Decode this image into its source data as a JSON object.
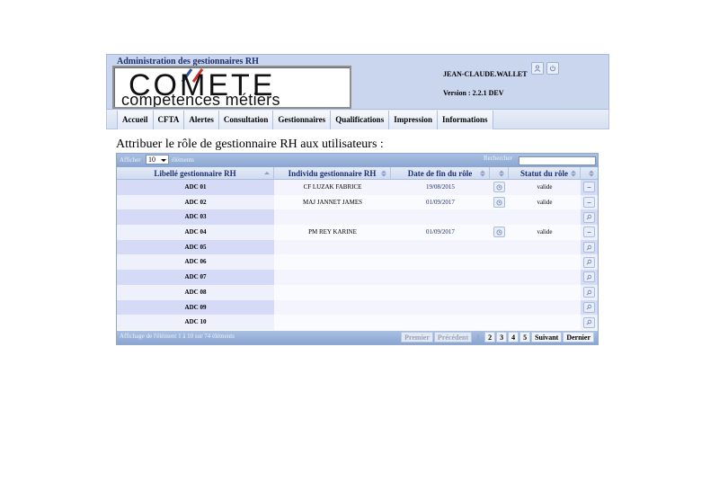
{
  "header": {
    "app_title": "Administration des gestionnaires RH",
    "logo": {
      "word": "COMETE",
      "subtitle": "compétences métiers"
    },
    "user_name": "JEAN-CLAUDE.WALLET",
    "version": "Version : 2.2.1 DEV",
    "icons": {
      "user": "user-icon",
      "power": "power-icon"
    }
  },
  "menu": [
    "Accueil",
    "CFTA",
    "Alertes",
    "Consultation",
    "Gestionnaires",
    "Qualifications",
    "Impression",
    "Informations"
  ],
  "page_title": "Attribuer le rôle de gestionnaire RH aux utilisateurs :",
  "table": {
    "show_label": "Afficher",
    "page_size": "10",
    "elements_label": "éléments",
    "search_label": "Rechercher",
    "search_value": "",
    "columns": {
      "libelle": "Libellé gestionnaire RH",
      "individu": "Individu gestionnaire RH",
      "date_fin": "Date de fin du rôle",
      "statut": "Statut du rôle"
    },
    "rows": [
      {
        "libelle": "ADC 01",
        "individu": "CF LUZAK FABRICE",
        "date_fin": "19/08/2015",
        "statut": "valide",
        "action": "minus"
      },
      {
        "libelle": "ADC 02",
        "individu": "MAJ JANNET JAMES",
        "date_fin": "01/09/2017",
        "statut": "valide",
        "action": "minus"
      },
      {
        "libelle": "ADC 03",
        "individu": "",
        "date_fin": "",
        "statut": "",
        "action": "search"
      },
      {
        "libelle": "ADC 04",
        "individu": "PM REY KARINE",
        "date_fin": "01/09/2017",
        "statut": "valide",
        "action": "minus"
      },
      {
        "libelle": "ADC 05",
        "individu": "",
        "date_fin": "",
        "statut": "",
        "action": "search"
      },
      {
        "libelle": "ADC 06",
        "individu": "",
        "date_fin": "",
        "statut": "",
        "action": "search"
      },
      {
        "libelle": "ADC 07",
        "individu": "",
        "date_fin": "",
        "statut": "",
        "action": "search"
      },
      {
        "libelle": "ADC 08",
        "individu": "",
        "date_fin": "",
        "statut": "",
        "action": "search"
      },
      {
        "libelle": "ADC 09",
        "individu": "",
        "date_fin": "",
        "statut": "",
        "action": "search"
      },
      {
        "libelle": "ADC 10",
        "individu": "",
        "date_fin": "",
        "statut": "",
        "action": "search"
      }
    ],
    "info": "Affichage de l'élément 1 à 10 sur 74 éléments",
    "pager": {
      "first": "Premier",
      "previous": "Précédent",
      "pages": [
        "1",
        "2",
        "3",
        "4",
        "5"
      ],
      "current": "1",
      "next": "Suivant",
      "last": "Dernier"
    }
  },
  "colors": {
    "header_bg": "#c9d6ee",
    "table_bar": "#8aa5d1",
    "row_odd": "#d5dbf7",
    "row_even": "#eef0fb",
    "title_blue": "#1c2f6e"
  }
}
